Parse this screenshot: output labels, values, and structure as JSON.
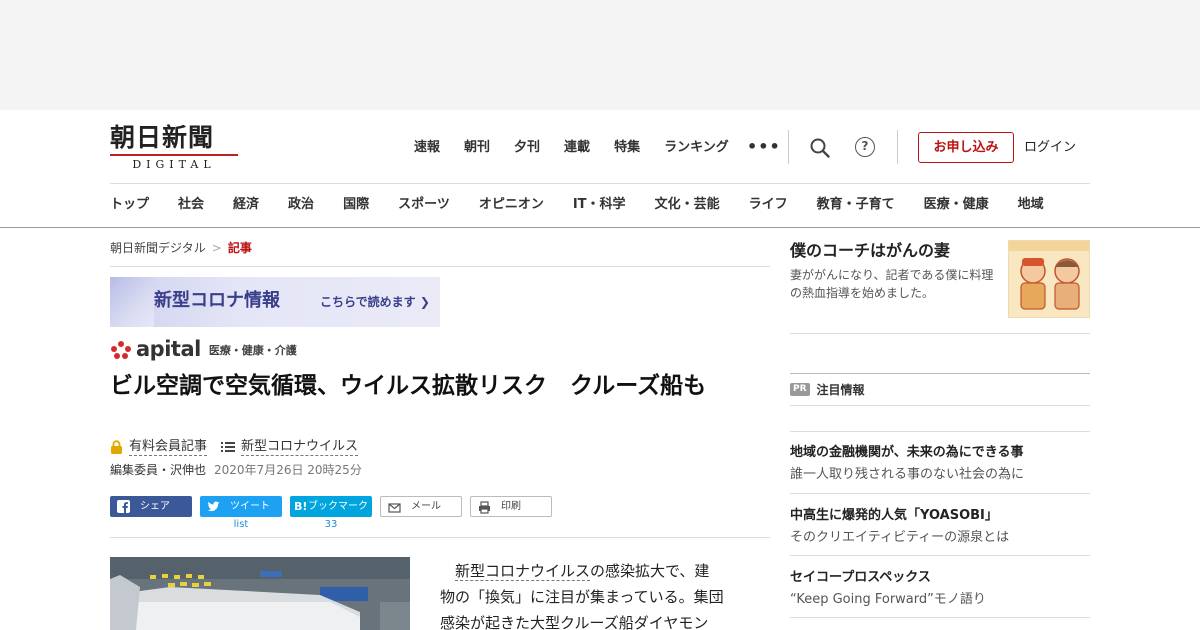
{
  "header": {
    "logo_text": "朝日新聞",
    "logo_sub": "DIGITAL",
    "top_nav": [
      "速報",
      "朝刊",
      "夕刊",
      "連載",
      "特集",
      "ランキング"
    ],
    "apply_label": "お申し込み",
    "login_label": "ログイン",
    "help_label": "?"
  },
  "category_nav": [
    "トップ",
    "社会",
    "経済",
    "政治",
    "国際",
    "スポーツ",
    "オピニオン",
    "IT・科学",
    "文化・芸能",
    "ライフ",
    "教育・子育て",
    "医療・健康",
    "地域"
  ],
  "breadcrumb": {
    "home": "朝日新聞デジタル",
    "separator": ">",
    "current": "記事"
  },
  "corona_banner": {
    "title": "新型コロナ情報",
    "link": "こちらで読めます ❯"
  },
  "apital": {
    "brand": "apital",
    "section": "医療・健康・介護"
  },
  "article": {
    "title": "ビル空調で空気循環、ウイルス拡散リスク　クルーズ船も",
    "paid_label": "有料会員記事",
    "tag_label": "新型コロナウイルス",
    "author": "編集委員・沢伸也",
    "date": "2020年7月26日 20時25分",
    "body_link": "新型コロナウイルス",
    "body_rest_1": "の感染拡大で、建",
    "body_line_2": "物の「換気」に注目が集まっている。集団",
    "body_line_3": "感染が起きた大型クルーズ船ダイヤモン"
  },
  "share": {
    "facebook": "シェア",
    "twitter": "ツイート",
    "twitter_count": "list",
    "hatena_mark": "B!",
    "hatena": "ブックマーク",
    "hatena_count": "33",
    "mail": "メール",
    "print": "印刷"
  },
  "sidebar": {
    "promo": {
      "title": "僕のコーチはがんの妻",
      "desc": "妻ががんになり、記者である僕に料理の熱血指導を始めました。"
    },
    "pr_badge": "PR",
    "pr_heading": "注目情報",
    "items": [
      {
        "title": "地域の金融機関が、未来の為にできる事",
        "desc": "誰一人取り残される事のない社会の為に"
      },
      {
        "title": "中高生に爆発的人気「YOASOBI」",
        "desc": "そのクリエイティビティーの源泉とは"
      },
      {
        "title": "セイコープロスペックス",
        "desc": "“Keep Going Forward”モノ語り"
      }
    ]
  },
  "colors": {
    "brand_red": "#b11111",
    "banner_text": "#3a3f8a",
    "facebook": "#3b5998",
    "twitter": "#1da1f2",
    "hatena": "#00a4de"
  }
}
